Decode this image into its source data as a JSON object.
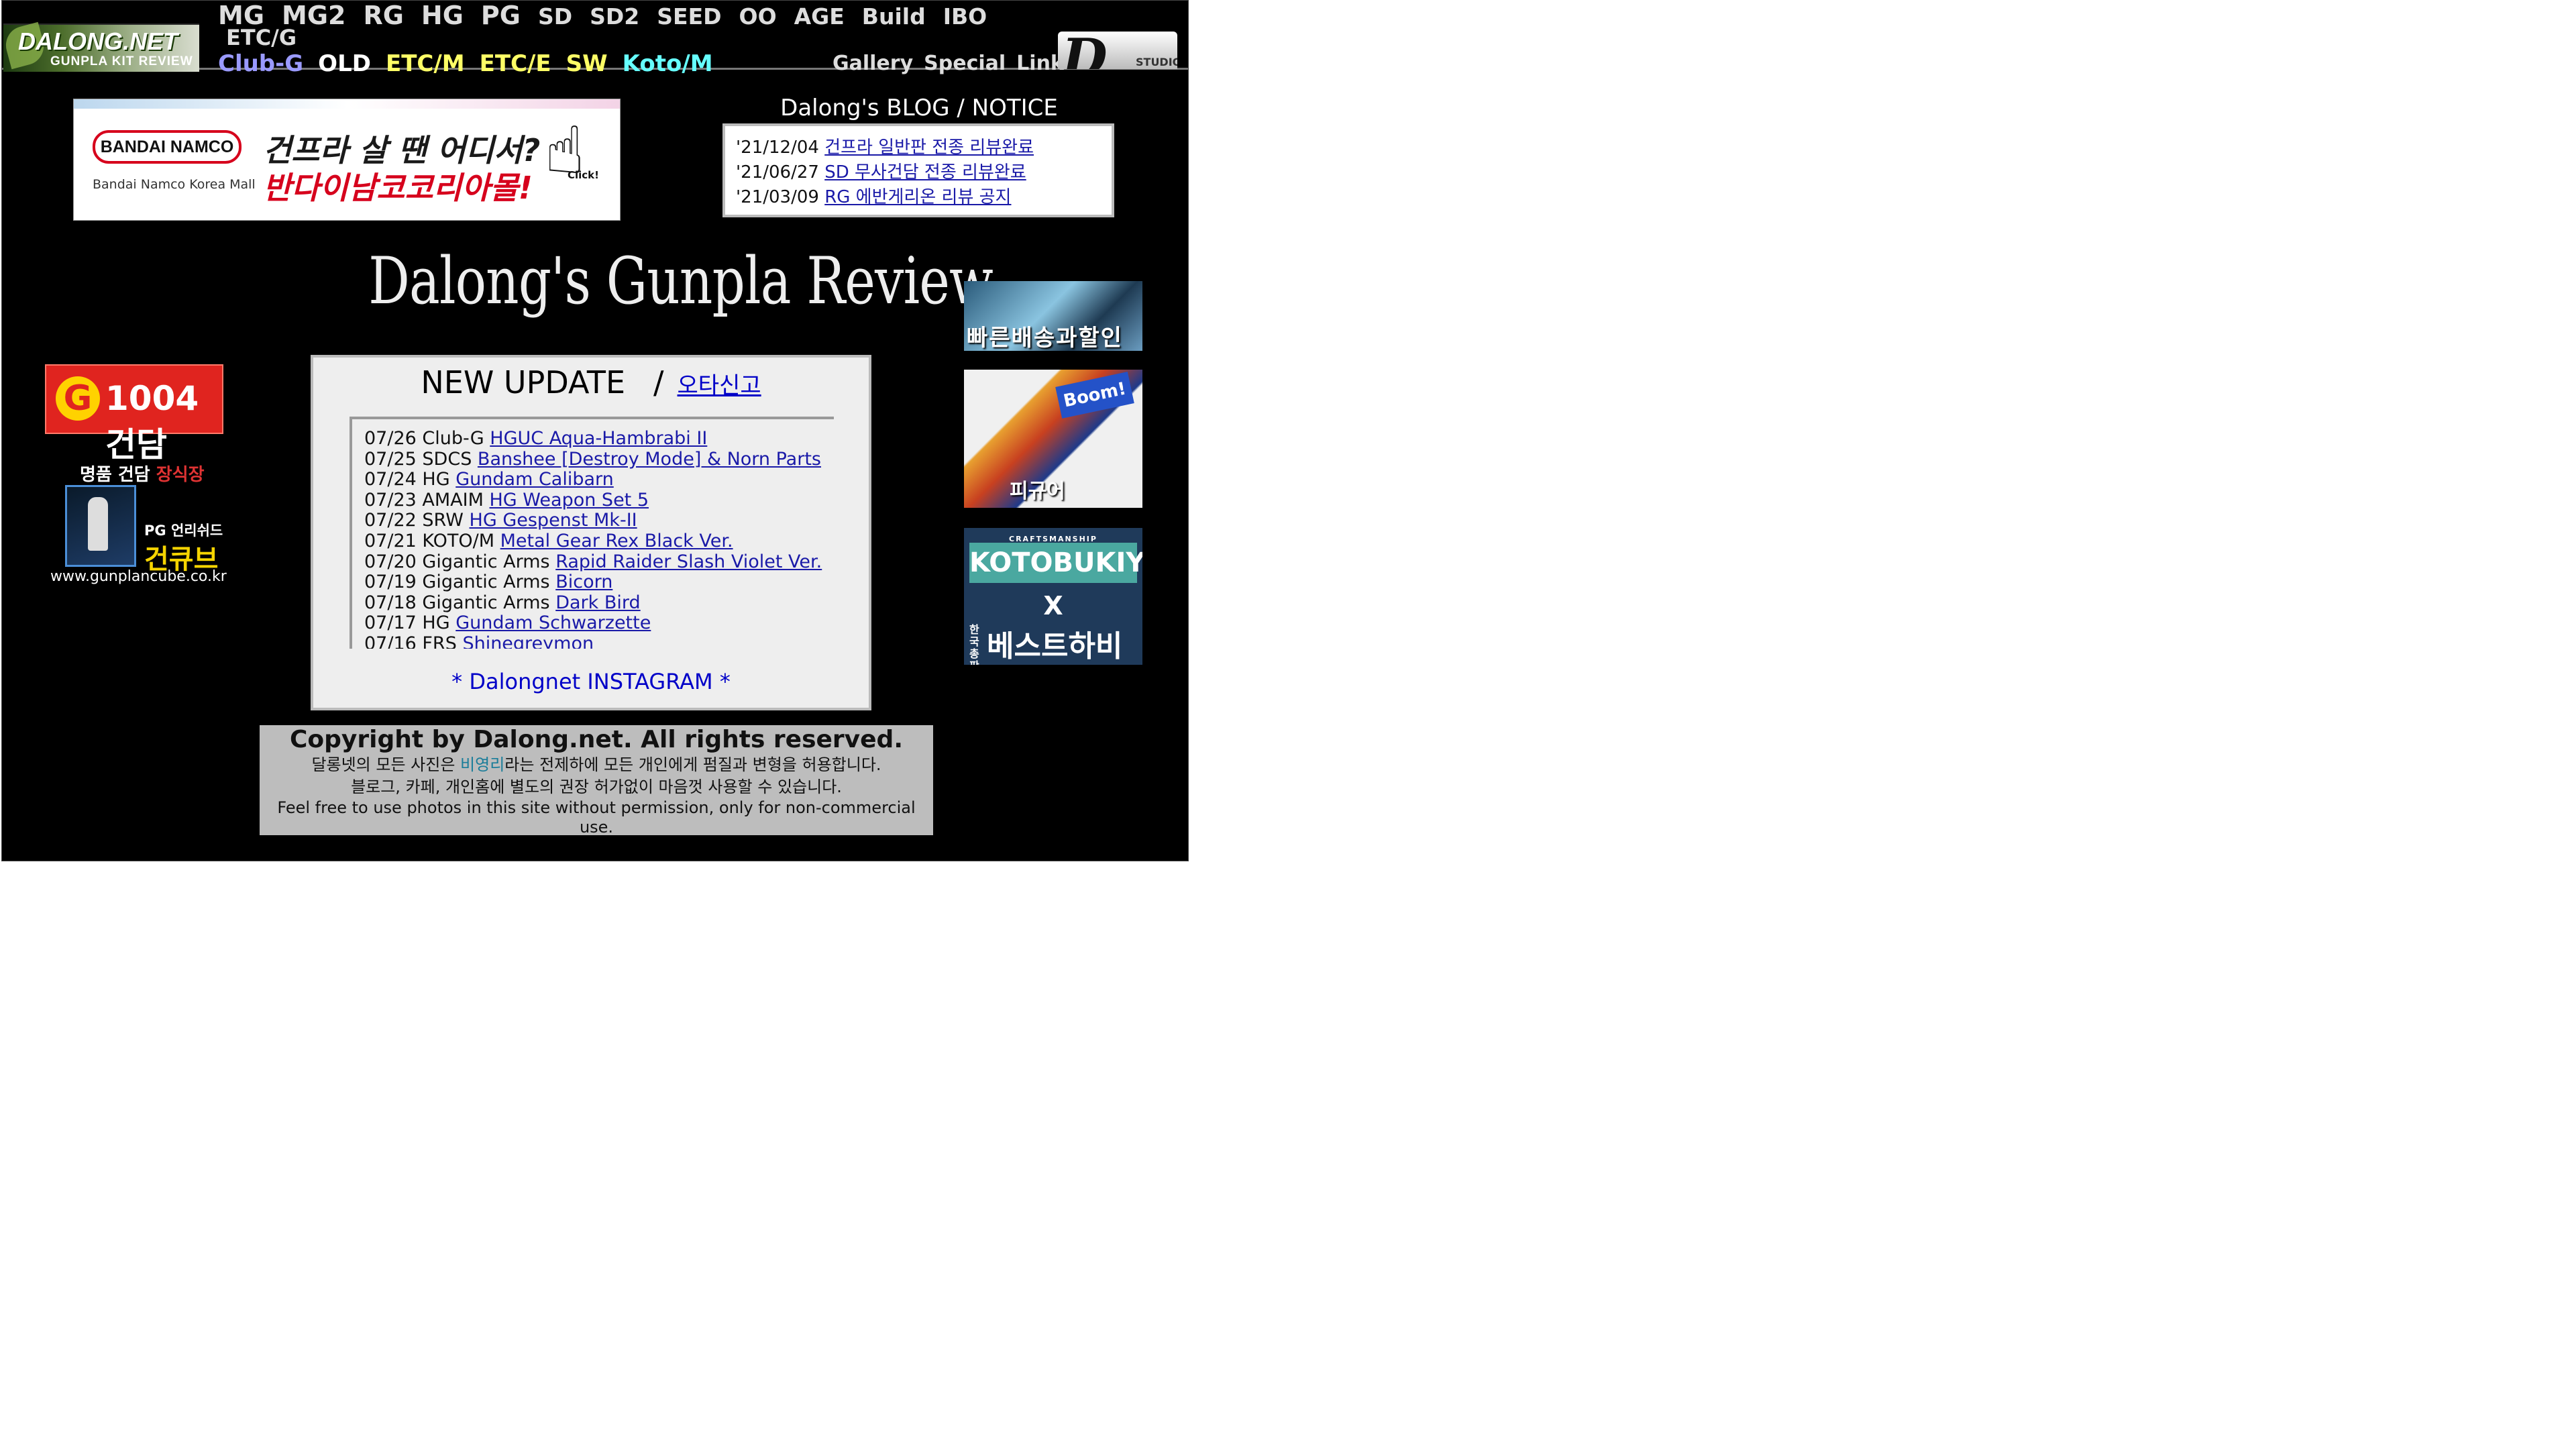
{
  "header": {
    "logo_main": "DALONG.NET",
    "logo_sub": "GUNPLA KIT REVIEW",
    "nav_row1": [
      "MG",
      "MG2",
      "RG",
      "HG",
      "PG"
    ],
    "nav_row1_small": [
      "SD",
      "SD2",
      "SEED",
      "OO",
      "AGE",
      "Build",
      "IBO"
    ],
    "nav_row1_wrap": "ETC/G",
    "nav_row2": [
      {
        "label": "Club-G",
        "color": "#9a9aff"
      },
      {
        "label": "OLD",
        "color": "#ffffff"
      },
      {
        "label": "ETC/M",
        "color": "#ffff66"
      },
      {
        "label": "ETC/E",
        "color": "#ffff66"
      },
      {
        "label": "SW",
        "color": "#ffff66"
      },
      {
        "label": "Koto/M",
        "color": "#66ffff"
      }
    ],
    "nav_right": [
      "Gallery",
      "Special",
      "Link"
    ],
    "badge_letter": "D",
    "badge_text": "STUDIO"
  },
  "banner_bandai": {
    "logo": "BANDAI NAMCO",
    "sub": "Bandai Namco Korea Mall",
    "headline1": "건프라 살 땐 어디서?",
    "headline2": "반다이남코코리아몰!",
    "click": "Click!"
  },
  "blog": {
    "title": "Dalong's BLOG / NOTICE",
    "items": [
      {
        "date": "'21/12/04",
        "link": "건프라 일반판 전종 리뷰완료"
      },
      {
        "date": "'21/06/27",
        "link": "SD 무사건담 전종 리뷰완료"
      },
      {
        "date": "'21/03/09",
        "link": "RG 에반게리온 리뷰 공지"
      }
    ]
  },
  "main_title": "Dalong's Gunpla Review",
  "left_ads": {
    "ad1": {
      "mark": "G",
      "label": "1004건담"
    },
    "ad2": {
      "top": "명품 건담 ",
      "top_red": "장식장",
      "pg": "PG 언리쉬드",
      "brand": "건큐브",
      "url": "www.gunplancube.co.kr"
    }
  },
  "update_panel": {
    "title": "NEW UPDATE",
    "separator": "/",
    "report_link": "오타신고",
    "items": [
      {
        "date": "07/26",
        "cat": "Club-G",
        "link": "HGUC Aqua-Hambrabi II"
      },
      {
        "date": "07/25",
        "cat": "SDCS",
        "link": "Banshee [Destroy Mode] & Norn Parts"
      },
      {
        "date": "07/24",
        "cat": "HG",
        "link": "Gundam Calibarn"
      },
      {
        "date": "07/23",
        "cat": "AMAIM",
        "link": "HG Weapon Set 5"
      },
      {
        "date": "07/22",
        "cat": "SRW",
        "link": "HG Gespenst Mk-II"
      },
      {
        "date": "07/21",
        "cat": "KOTO/M",
        "link": "Metal Gear Rex Black Ver."
      },
      {
        "date": "07/20",
        "cat": "Gigantic Arms",
        "link": "Rapid Raider Slash Violet Ver."
      },
      {
        "date": "07/19",
        "cat": "Gigantic Arms",
        "link": "Bicorn"
      },
      {
        "date": "07/18",
        "cat": "Gigantic Arms",
        "link": "Dark Bird"
      },
      {
        "date": "07/17",
        "cat": "HG",
        "link": "Gundam Schwarzette"
      },
      {
        "date": "07/16",
        "cat": "FRS",
        "link": "Shinegreymon"
      }
    ],
    "instagram": "* Dalongnet INSTAGRAM *"
  },
  "copyright": {
    "line1": "Copyright by Dalong.net. All rights reserved.",
    "line2_pre": "달롱넷의 모든 사진은 ",
    "line2_hl": "비영리",
    "line2_post": "라는 전제하에 모든 개인에게 펌질과 변형을 허용합니다.",
    "line3": "블로그, 카페, 개인홈에 별도의 권장 허가없이 마음껏 사용할 수 있습니다.",
    "line4": "Feel free to use photos in this site without permission, only for non-commercial use."
  },
  "right_ads": {
    "ad1": "빠른배송과할인",
    "ad2_badge": "Boom!",
    "ad2": "피규어",
    "ad3_craft": "CRAFTSMANSHIP",
    "ad3_brand": "KOTOBUKIYA",
    "ad3_x": "X",
    "ad3_small": "한국 총판",
    "ad3_partner": "베스트하비"
  }
}
